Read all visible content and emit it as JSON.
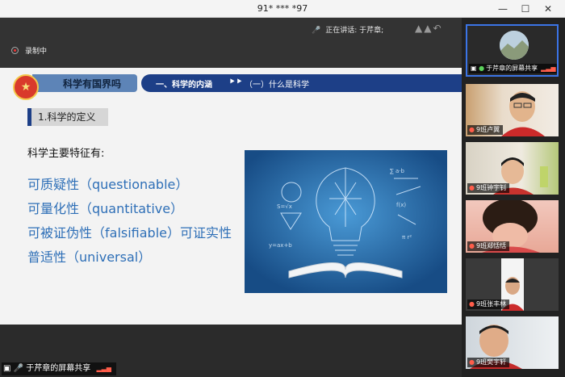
{
  "window": {
    "title": "91* *** *97"
  },
  "topbar": {
    "speaking_label": "正在讲话: 于芹章;",
    "recording_label": "录制中"
  },
  "slide": {
    "brand": "科学有国界吗",
    "section": "一、科学的内涵",
    "subsection": "（一）什么是科学",
    "definition_title": "1.科学的定义",
    "features_heading": "科学主要特征有:",
    "features": [
      "可质疑性（questionable）",
      "可量化性（quantitative）",
      "可被证伪性（falsifiable）可证实性",
      "普适性（universal）"
    ]
  },
  "share_label": "于芹章的屏幕共享",
  "participants": [
    {
      "name": "于芹章的屏幕共享"
    },
    {
      "name": "9班卢翼"
    },
    {
      "name": "9班钟宇钊"
    },
    {
      "name": "9班郑恬恬"
    },
    {
      "name": "9班张丰林"
    },
    {
      "name": "9班樊宇轩"
    }
  ],
  "colors": {
    "banner_dark": "#1d3f87",
    "banner_light": "#5d84b7",
    "feature_text": "#2e6fb7"
  }
}
